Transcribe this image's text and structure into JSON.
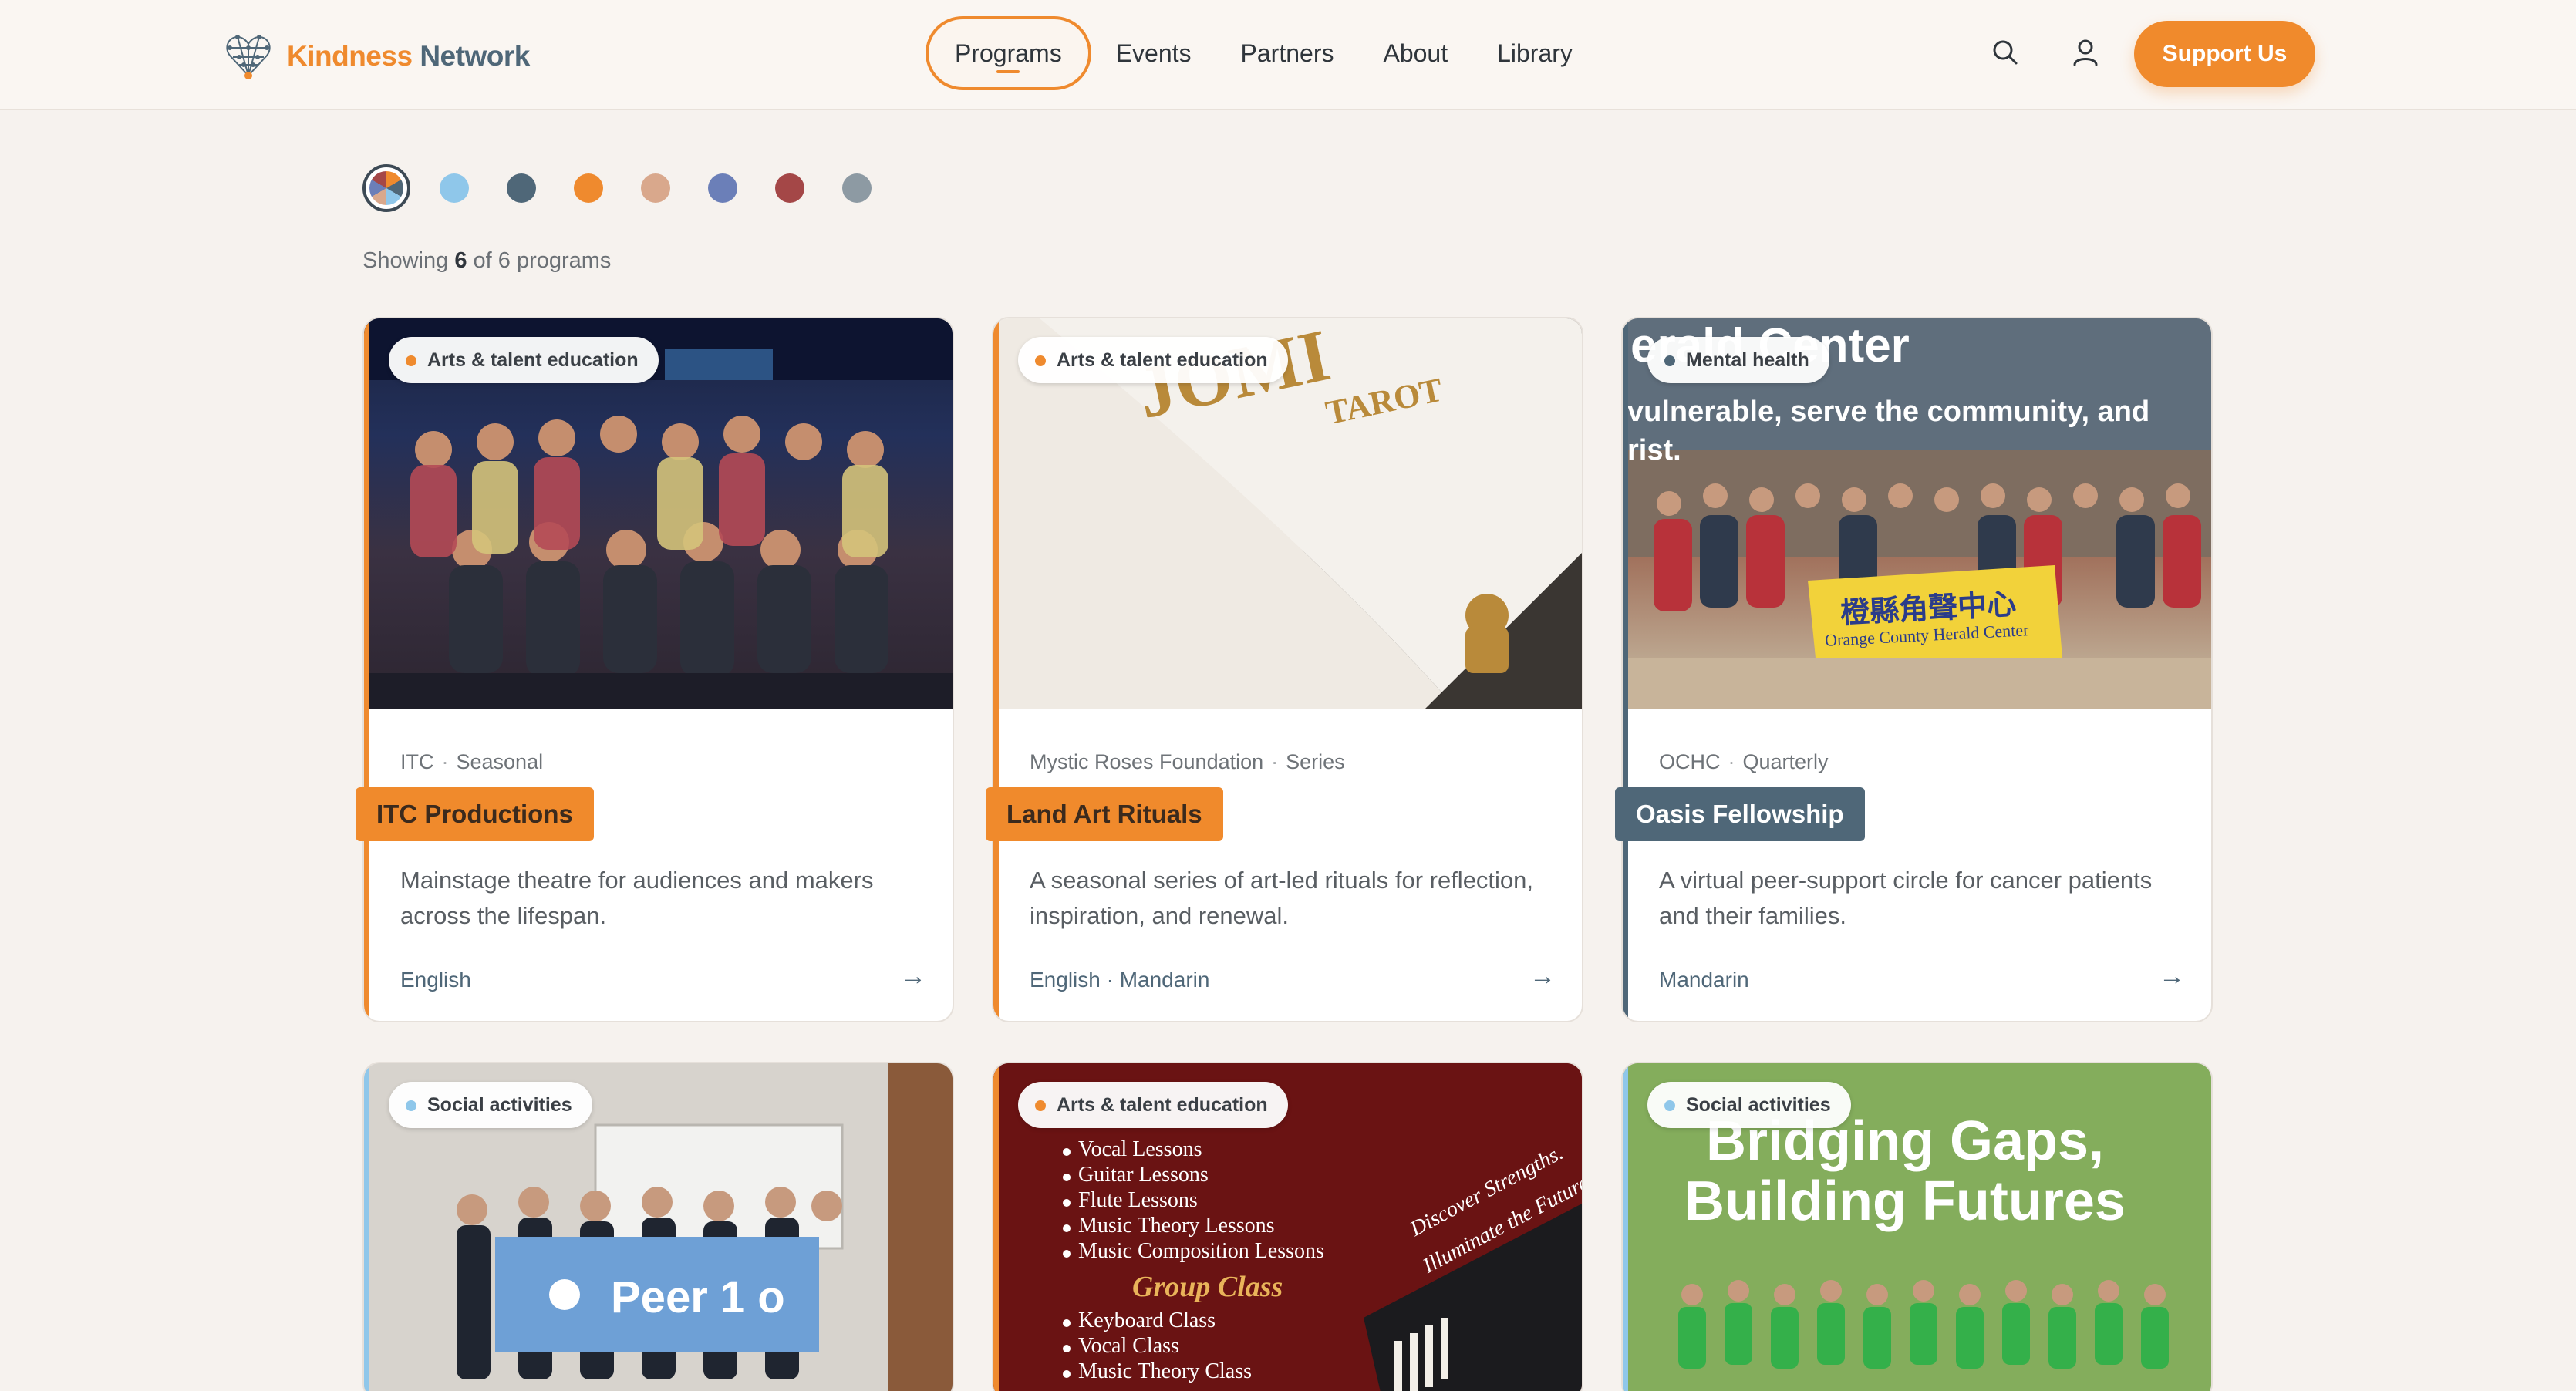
{
  "header": {
    "brand_first": "Kindness",
    "brand_second": "Network",
    "nav": [
      "Programs",
      "Events",
      "Partners",
      "About",
      "Library"
    ],
    "active_nav": "Programs",
    "support_label": "Support Us"
  },
  "filters": {
    "colors": [
      "#8fc7ea",
      "#4f6778",
      "#ef8a2e",
      "#d9a88c",
      "#6b7fb8",
      "#a44747",
      "#8d9aa3"
    ]
  },
  "summary": {
    "prefix": "Showing",
    "shown": "6",
    "middle": "of 6 programs"
  },
  "cards": [
    {
      "category": "Arts & talent education",
      "category_color": "#ef8a2e",
      "org": "ITC",
      "frequency": "Seasonal",
      "title": "ITC Productions",
      "description": "Mainstage theatre for audiences and makers across the lifespan.",
      "languages": "English",
      "arrow": "→"
    },
    {
      "category": "Arts & talent education",
      "category_color": "#ef8a2e",
      "org": "Mystic Roses Foundation",
      "frequency": "Series",
      "title": "Land Art Rituals",
      "description": "A seasonal series of art-led rituals for reflection, inspiration, and renewal.",
      "languages": "English · Mandarin",
      "arrow": "→",
      "photo_text": [
        "JOMI",
        "TAROT"
      ]
    },
    {
      "category": "Mental health",
      "category_color": "#4f6778",
      "org": "OCHC",
      "frequency": "Quarterly",
      "title": "Oasis Fellowship",
      "description": "A virtual peer-support circle for cancer patients and their families.",
      "languages": "Mandarin",
      "arrow": "→",
      "photo_text": [
        "erald Center",
        "vulnerable, serve the community, and",
        "rist.",
        "橙縣角聲中心",
        "Orange County Herald Center"
      ]
    },
    {
      "category": "Social activities",
      "category_color": "#8fc7ea",
      "photo_text": [
        "Peer 1 o"
      ]
    },
    {
      "category": "Arts & talent education",
      "category_color": "#ef8a2e",
      "photo_text": [
        "Vocal Lessons",
        "Guitar Lessons",
        "Flute Lessons",
        "Music Theory Lessons",
        "Music Composition Lessons",
        "Group Class",
        "Keyboard Class",
        "Vocal Class",
        "Music Theory Class",
        "Discover Strengths.",
        "Illuminate the Future."
      ]
    },
    {
      "category": "Social activities",
      "category_color": "#8fc7ea",
      "photo_text": [
        "Bridging Gaps,",
        "Building Futures"
      ]
    }
  ]
}
